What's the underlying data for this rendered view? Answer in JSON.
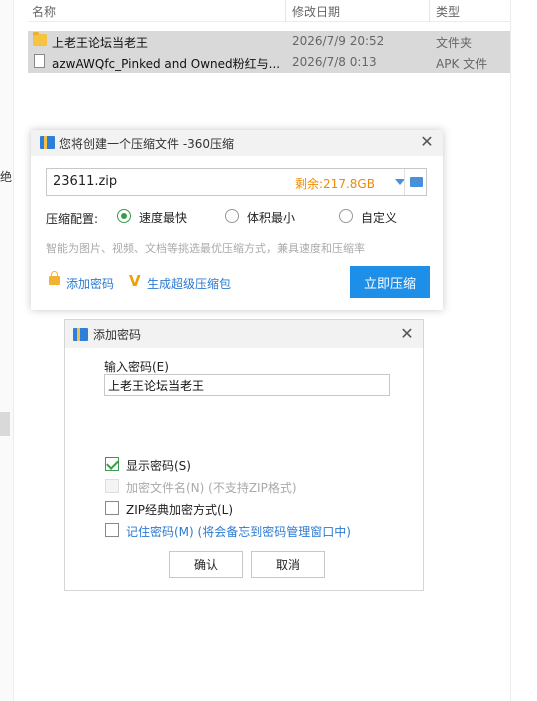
{
  "explorer": {
    "columns": {
      "name": "名称",
      "date": "修改日期",
      "type": "类型"
    },
    "rows": [
      {
        "name": "上老王论坛当老王",
        "date": "2026/7/9 20:52",
        "type": "文件夹",
        "icon": "folder-icon",
        "selected": true
      },
      {
        "name": "azwAWQfc_Pinked and Owned粉红与...",
        "date": "2026/7/8 0:13",
        "type": "APK 文件",
        "icon": "file-icon",
        "selected": true
      }
    ],
    "left_fragment": "绝"
  },
  "compress_dialog": {
    "title": "您将创建一个压缩文件 -360压缩",
    "filename": "23611.zip",
    "free_space": "剩余:217.8GB",
    "config_label": "压缩配置:",
    "options": [
      {
        "label": "速度最快",
        "selected": true
      },
      {
        "label": "体积最小",
        "selected": false
      },
      {
        "label": "自定义",
        "selected": false
      }
    ],
    "hint": "智能为图片、视频、文档等挑选最优压缩方式，兼具速度和压缩率",
    "add_password_label": "添加密码",
    "super_package_label": "生成超级压缩包",
    "compress_button": "立即压缩",
    "accent_color": "#1e8fe8"
  },
  "password_dialog": {
    "title": "添加密码",
    "input_label": "输入密码(E)",
    "password_value": "上老王论坛当老王",
    "checkboxes": [
      {
        "label": "显示密码(S)",
        "checked": true,
        "disabled": false
      },
      {
        "label": "加密文件名(N) (不支持ZIP格式)",
        "checked": false,
        "disabled": true
      },
      {
        "label": "ZIP经典加密方式(L)",
        "checked": false,
        "disabled": false
      },
      {
        "label": "记住密码(M) (将会备忘到密码管理窗口中)",
        "checked": false,
        "disabled": false
      }
    ],
    "ok_button": "确认",
    "cancel_button": "取消",
    "check_color": "#3a9b4a"
  }
}
